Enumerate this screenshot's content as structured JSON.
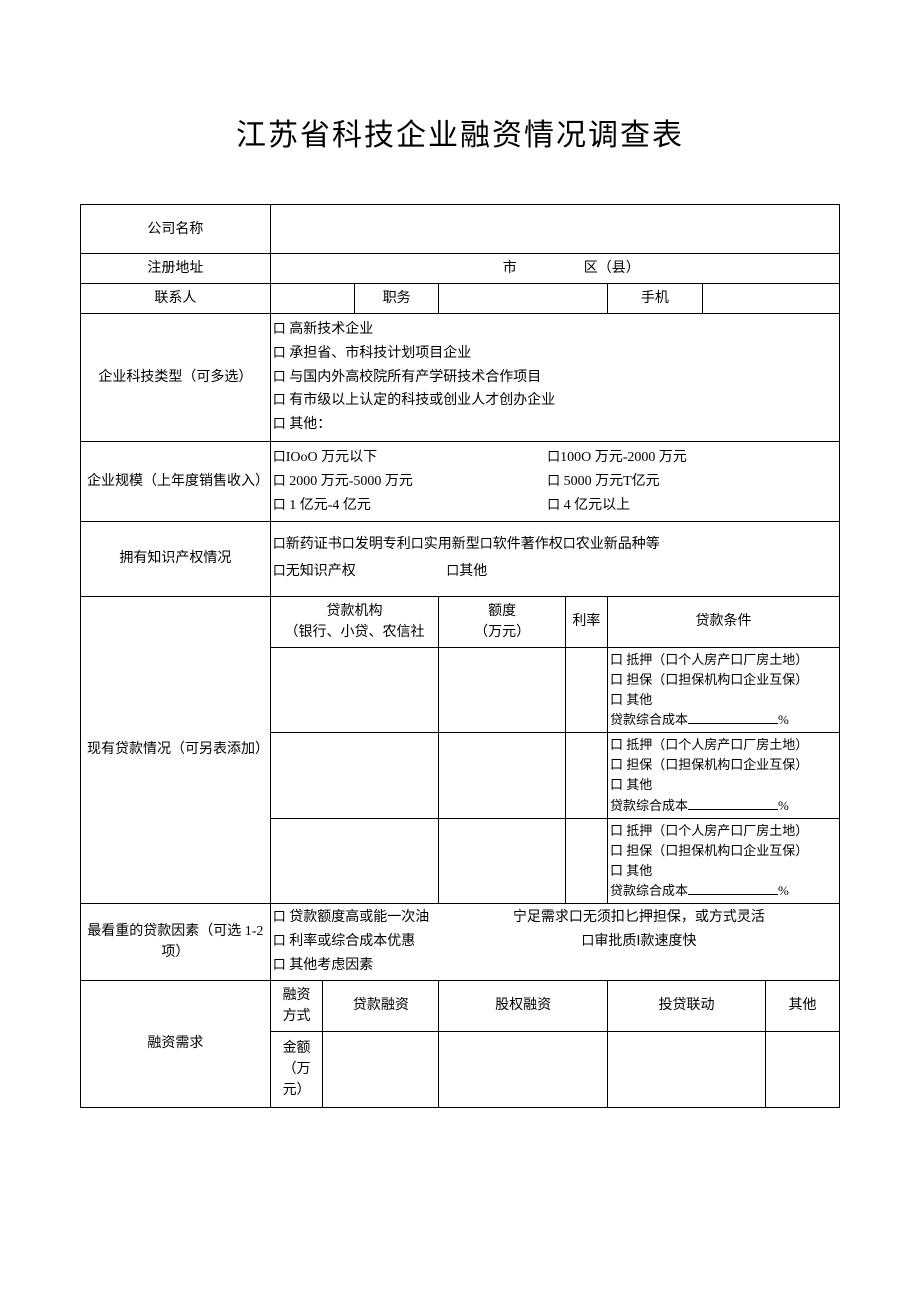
{
  "title": "江苏省科技企业融资情况调查表",
  "labels": {
    "company_name": "公司名称",
    "reg_addr": "注册地址",
    "contact": "联系人",
    "tech_type": "企业科技类型（可多选）",
    "scale": "企业规模（上年度销售收入）",
    "ip": "拥有知识产权情况",
    "loans": "现有贷款情况（可另表添加）",
    "factors": "最看重的贷款因素（可选 1-2 项）",
    "demand": "融资需求"
  },
  "addr": {
    "city": "市",
    "area": "区（县）"
  },
  "contact_row": {
    "position": "职务",
    "mobile": "手机"
  },
  "tech_opts": {
    "o1": "高新技术企业",
    "o2": "承担省、市科技计划项目企业",
    "o3": "与国内外高校院所有产学研技术合作项目",
    "o4": "有市级以上认定的科技或创业人才创办企业",
    "o5": "其他："
  },
  "scale_opts": {
    "s1": "IOoO 万元以下",
    "s2": "100O 万元-2000 万元",
    "s3": "2000 万元-5000 万元",
    "s4": "5000 万元T亿元",
    "s5": "1 亿元-4 亿元",
    "s6": "4 亿元以上"
  },
  "ip_opts": {
    "i1": "新药证书",
    "i2": "发明专利",
    "i3": "实用新型",
    "i4": "软件著作权",
    "i5": "农业新品种等",
    "none": "无知识产权",
    "other": "其他"
  },
  "loan_hdr": {
    "inst": "贷款机构",
    "inst_sub": "（银行、小贷、农信社",
    "amount": "额度",
    "amount_unit": "（万元）",
    "rate": "利率",
    "cond": "贷款条件"
  },
  "loan_cond": {
    "mortgage": "抵押（口个人房产口厂房土地）",
    "guarantee": "担保（口担保机构口企业互保）",
    "other": "其他",
    "cost": "贷款综合成本",
    "pct": "%"
  },
  "factor_opts": {
    "f1": "贷款额度高或能一次油",
    "f1b": "宁足需求口无须扣匕押担保，或方式灵活",
    "f2": "利率或综合成本优惠",
    "f2b": "审批质Ⅰ款速度快",
    "f3": "其他考虑因素"
  },
  "demand_row": {
    "mode": "融资方式",
    "loan": "贷款融资",
    "equity": "股权融资",
    "linked": "投贷联动",
    "other": "其他",
    "amount": "金额（万元）"
  },
  "box": "口"
}
